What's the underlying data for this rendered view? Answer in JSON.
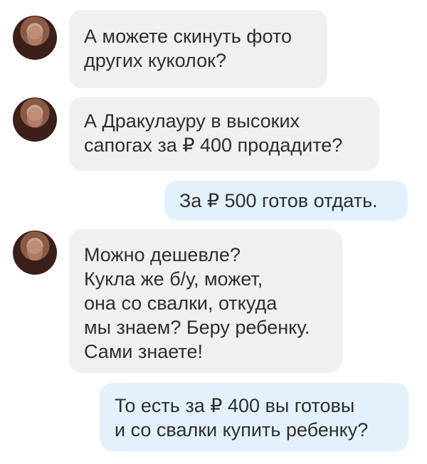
{
  "messages": [
    {
      "id": "m1",
      "direction": "incoming",
      "text": "А можете скинуть фото\nдругих куколок?"
    },
    {
      "id": "m2",
      "direction": "incoming",
      "text": "А Дракулауру в высоких\nсапогах за ₽ 400 продадите?"
    },
    {
      "id": "m3",
      "direction": "outgoing",
      "text": "За ₽ 500 готов отдать."
    },
    {
      "id": "m4",
      "direction": "incoming",
      "text": "Можно дешевле?\nКукла же б/у, может,\nона со свалки, откуда\nмы знаем? Беру ребенку.\nСами знаете!"
    },
    {
      "id": "m5",
      "direction": "outgoing",
      "text": "То есть за ₽ 400 вы готовы\nи со свалки купить ребенку?"
    }
  ],
  "colors": {
    "incoming_bubble": "#f0f0f0",
    "outgoing_bubble": "#e2f1fb",
    "text": "#2e2e2e",
    "background": "#ffffff"
  },
  "icons": {
    "avatar": "contact-avatar-photo"
  }
}
